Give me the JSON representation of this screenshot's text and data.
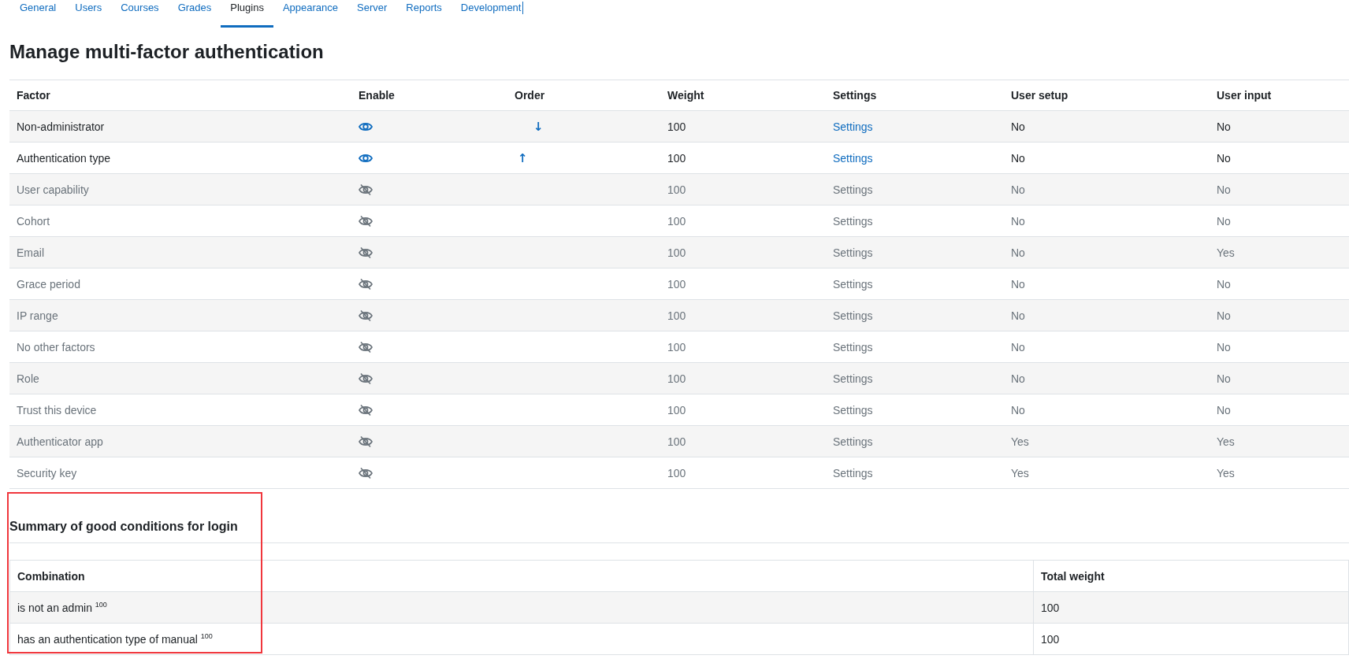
{
  "tabs": [
    {
      "label": "General",
      "selected": false
    },
    {
      "label": "Users",
      "selected": false
    },
    {
      "label": "Courses",
      "selected": false
    },
    {
      "label": "Grades",
      "selected": false
    },
    {
      "label": "Plugins",
      "selected": true
    },
    {
      "label": "Appearance",
      "selected": false
    },
    {
      "label": "Server",
      "selected": false
    },
    {
      "label": "Reports",
      "selected": false
    },
    {
      "label": "Development",
      "selected": false
    }
  ],
  "title": "Manage multi-factor authentication",
  "factors": {
    "columns": [
      "Factor",
      "Enable",
      "Order",
      "Weight",
      "Settings",
      "User setup",
      "User input"
    ],
    "rows": [
      {
        "factor": "Non-administrator",
        "enabled": true,
        "order": "↓",
        "weight": "100",
        "settings": "Settings",
        "user_setup": "No",
        "user_input": "No"
      },
      {
        "factor": "Authentication type",
        "enabled": true,
        "order": "↑",
        "weight": "100",
        "settings": "Settings",
        "user_setup": "No",
        "user_input": "No"
      },
      {
        "factor": "User capability",
        "enabled": false,
        "weight": "100",
        "settings": "Settings",
        "user_setup": "No",
        "user_input": "No"
      },
      {
        "factor": "Cohort",
        "enabled": false,
        "weight": "100",
        "settings": "Settings",
        "user_setup": "No",
        "user_input": "No"
      },
      {
        "factor": "Email",
        "enabled": false,
        "weight": "100",
        "settings": "Settings",
        "user_setup": "No",
        "user_input": "Yes"
      },
      {
        "factor": "Grace period",
        "enabled": false,
        "weight": "100",
        "settings": "Settings",
        "user_setup": "No",
        "user_input": "No"
      },
      {
        "factor": "IP range",
        "enabled": false,
        "weight": "100",
        "settings": "Settings",
        "user_setup": "No",
        "user_input": "No"
      },
      {
        "factor": "No other factors",
        "enabled": false,
        "weight": "100",
        "settings": "Settings",
        "user_setup": "No",
        "user_input": "No"
      },
      {
        "factor": "Role",
        "enabled": false,
        "weight": "100",
        "settings": "Settings",
        "user_setup": "No",
        "user_input": "No"
      },
      {
        "factor": "Trust this device",
        "enabled": false,
        "weight": "100",
        "settings": "Settings",
        "user_setup": "No",
        "user_input": "No"
      },
      {
        "factor": "Authenticator app",
        "enabled": false,
        "weight": "100",
        "settings": "Settings",
        "user_setup": "Yes",
        "user_input": "Yes"
      },
      {
        "factor": "Security key",
        "enabled": false,
        "weight": "100",
        "settings": "Settings",
        "user_setup": "Yes",
        "user_input": "Yes"
      }
    ]
  },
  "summary": {
    "title": "Summary of good conditions for login",
    "columns": [
      "Combination",
      "Total weight"
    ],
    "rows": [
      {
        "combination": "is not an admin $^{100}$",
        "total_weight": "100"
      },
      {
        "combination": "has an authentication type of manual $^{100}$",
        "total_weight": "100"
      }
    ]
  }
}
